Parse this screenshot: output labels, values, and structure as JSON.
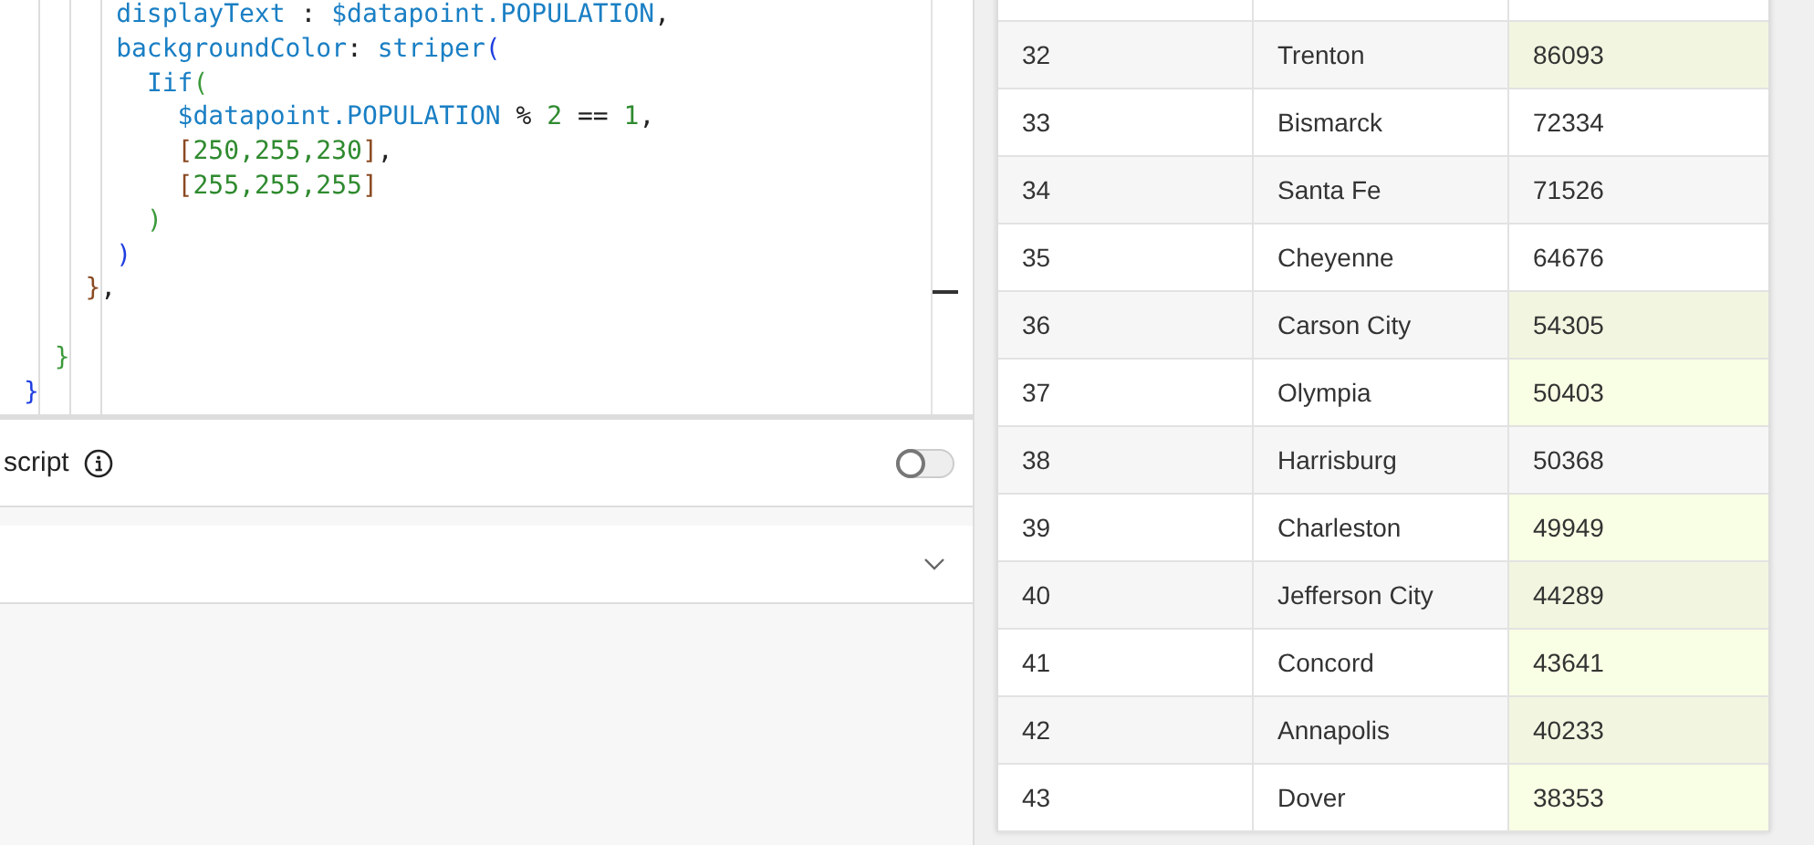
{
  "code_editor": {
    "lines": [
      [
        {
          "text": "displayText",
          "kind": "ident"
        },
        {
          "text": " : ",
          "kind": "op"
        },
        {
          "text": "$datapoint.POPULATION",
          "kind": "ident"
        },
        {
          "text": ",",
          "kind": "op"
        }
      ],
      [
        {
          "text": "backgroundColor",
          "kind": "ident"
        },
        {
          "text": ": ",
          "kind": "op"
        },
        {
          "text": "striper",
          "kind": "ident"
        },
        {
          "text": "(",
          "kind": "paren1"
        }
      ],
      [
        {
          "text": "Iif",
          "kind": "ident"
        },
        {
          "text": "(",
          "kind": "paren2"
        }
      ],
      [
        {
          "text": "$datapoint.POPULATION",
          "kind": "ident"
        },
        {
          "text": " % ",
          "kind": "op"
        },
        {
          "text": "2",
          "kind": "num"
        },
        {
          "text": " == ",
          "kind": "op"
        },
        {
          "text": "1",
          "kind": "num"
        },
        {
          "text": ",",
          "kind": "op"
        }
      ],
      [
        {
          "text": "[",
          "kind": "paren3"
        },
        {
          "text": "250,255,230",
          "kind": "num"
        },
        {
          "text": "]",
          "kind": "paren3"
        },
        {
          "text": ",",
          "kind": "op"
        }
      ],
      [
        {
          "text": "[",
          "kind": "paren3"
        },
        {
          "text": "255,255,255",
          "kind": "num"
        },
        {
          "text": "]",
          "kind": "paren3"
        }
      ],
      [
        {
          "text": ")",
          "kind": "paren2"
        }
      ],
      [
        {
          "text": ")",
          "kind": "paren1"
        }
      ],
      [
        {
          "text": "}",
          "kind": "paren3"
        },
        {
          "text": ",",
          "kind": "op"
        }
      ],
      [
        {
          "text": "}",
          "kind": "paren2"
        }
      ],
      [
        {
          "text": "}",
          "kind": "paren1"
        }
      ]
    ]
  },
  "script_setting": {
    "label": "script",
    "on": false
  },
  "collapsed_section": {
    "expanded": false
  },
  "table": {
    "rows": [
      {
        "cells": [
          "32",
          "Trenton",
          "86093"
        ],
        "highlighted": true
      },
      {
        "cells": [
          "33",
          "Bismarck",
          "72334"
        ],
        "highlighted": false
      },
      {
        "cells": [
          "34",
          "Santa Fe",
          "71526"
        ],
        "highlighted": false
      },
      {
        "cells": [
          "35",
          "Cheyenne",
          "64676"
        ],
        "highlighted": false
      },
      {
        "cells": [
          "36",
          "Carson City",
          "54305"
        ],
        "highlighted": true
      },
      {
        "cells": [
          "37",
          "Olympia",
          "50403"
        ],
        "highlighted": true
      },
      {
        "cells": [
          "38",
          "Harrisburg",
          "50368"
        ],
        "highlighted": false
      },
      {
        "cells": [
          "39",
          "Charleston",
          "49949"
        ],
        "highlighted": true
      },
      {
        "cells": [
          "40",
          "Jefferson City",
          "44289"
        ],
        "highlighted": true
      },
      {
        "cells": [
          "41",
          "Concord",
          "43641"
        ],
        "highlighted": true
      },
      {
        "cells": [
          "42",
          "Annapolis",
          "40233"
        ],
        "highlighted": true
      },
      {
        "cells": [
          "43",
          "Dover",
          "38353"
        ],
        "highlighted": true
      }
    ]
  }
}
